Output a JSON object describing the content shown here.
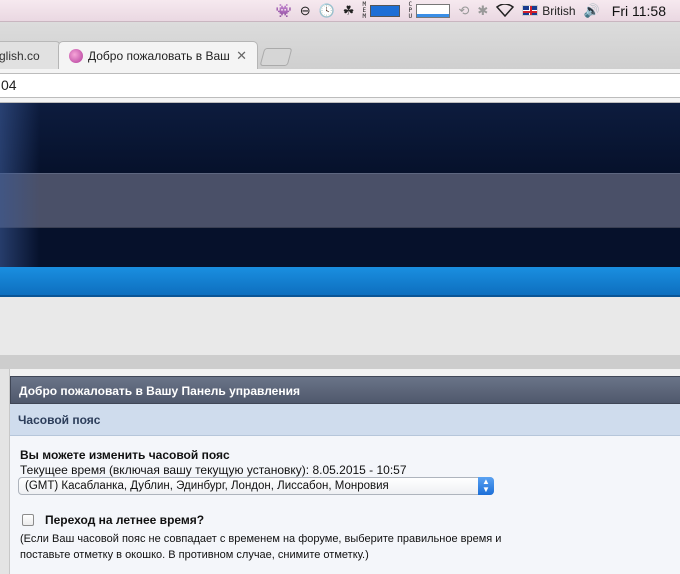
{
  "menubar": {
    "icons": [
      "alien-icon",
      "circle-slash-icon",
      "clock-icon",
      "leaf-icon",
      "memory-meter-icon",
      "cpu-graph-icon",
      "time-machine-icon",
      "bluetooth-icon",
      "wifi-icon",
      "uk-flag-icon",
      "volume-icon"
    ],
    "mem_label": "MEM",
    "cpu_label": "CPU",
    "input_language": "British",
    "clock": "Fri 11:58"
  },
  "browser": {
    "inactive_tab_title": "glish.co",
    "active_tab_title": "Добро пожаловать в Ваш",
    "address_text": "04"
  },
  "panel": {
    "title": "Добро пожаловать в Вашу Панель управления",
    "section": "Часовой пояс",
    "tz_heading": "Вы можете изменить часовой пояс",
    "tz_current": "Текущее время (включая вашу текущую установку): 8.05.2015 - 10:57",
    "tz_selected": "(GMT) Касабланка, Дублин, Эдинбург, Лондон, Лиссабон, Монровия",
    "dst_label": "Переход на летнее время?",
    "dst_checked": false,
    "dst_help": "(Если Ваш часовой пояс не совпадает с временем на форуме, выберите правильное время и поставьте отметку в окошко. В противном случае, снимите отметку.)"
  },
  "colors": {
    "header_dark": "#071430",
    "header_mid": "#4a5068",
    "accent_blue": "#1a8fe0",
    "panel_title_bg": "#5b6478",
    "subhead_bg": "#cfdced"
  }
}
